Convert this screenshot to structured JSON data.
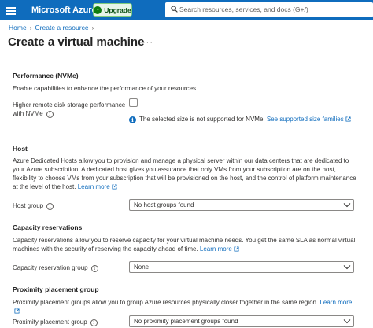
{
  "header": {
    "brand": "Microsoft Azure",
    "upgrade_label": "Upgrade",
    "search_placeholder": "Search resources, services, and docs (G+/)"
  },
  "breadcrumb": [
    "Home",
    "Create a resource"
  ],
  "page": {
    "title": "Create a virtual machine",
    "more": "···"
  },
  "performance": {
    "title": "Performance (NVMe)",
    "description": "Enable capabilities to enhance the performance of your resources.",
    "field_label_line1": "Higher remote disk storage performance",
    "field_label_line2": "with NVMe",
    "checked": false,
    "notice_text": "The selected size is not supported for NVMe.",
    "notice_link": "See supported size families"
  },
  "host": {
    "title": "Host",
    "description": "Azure Dedicated Hosts allow you to provision and manage a physical server within our data centers that are dedicated to your Azure subscription. A dedicated host gives you assurance that only VMs from your subscription are on the host, flexibility to choose VMs from your subscription that will be provisioned on the host, and the control of platform maintenance at the level of the host.",
    "learn_more": "Learn more",
    "field_label": "Host group",
    "field_value": "No host groups found"
  },
  "capacity": {
    "title": "Capacity reservations",
    "description": "Capacity reservations allow you to reserve capacity for your virtual machine needs. You get the same SLA as normal virtual machines with the security of reserving the capacity ahead of time.",
    "learn_more": "Learn more",
    "field_label": "Capacity reservation group",
    "field_value": "None"
  },
  "proximity": {
    "title": "Proximity placement group",
    "description": "Proximity placement groups allow you to group Azure resources physically closer together in the same region.",
    "learn_more": "Learn more",
    "field_label": "Proximity placement group",
    "field_value": "No proximity placement groups found"
  },
  "colors": {
    "accent": "#0f6cbd",
    "upgrade_bg": "#e7f5e9",
    "text": "#323130"
  }
}
